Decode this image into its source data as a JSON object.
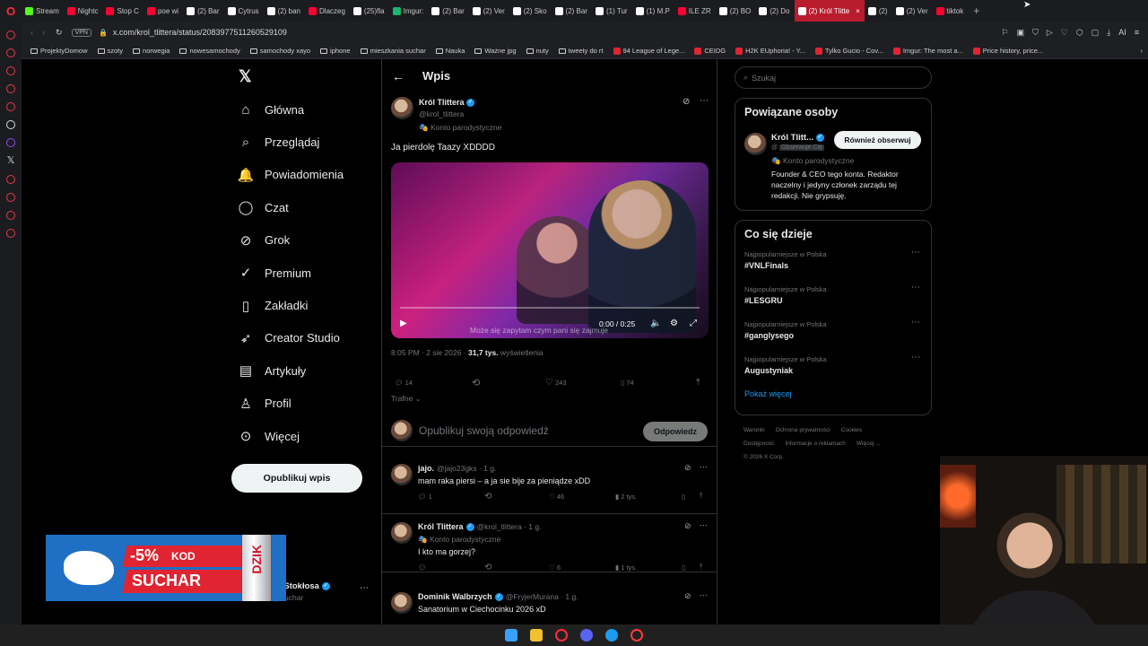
{
  "browser": {
    "tabs": [
      {
        "label": "Stream",
        "color": "#53fc18"
      },
      {
        "label": "Nightc",
        "color": "#ff0033"
      },
      {
        "label": "Stop C",
        "color": "#ff0033"
      },
      {
        "label": "poe wi",
        "color": "#ff0033"
      },
      {
        "label": "(2) Bar",
        "color": "#ffffff"
      },
      {
        "label": "Cytrus",
        "color": "#ffffff"
      },
      {
        "label": "(2) ban",
        "color": "#ffffff"
      },
      {
        "label": "Dlaczeg",
        "color": "#ff0033"
      },
      {
        "label": "(25)fla",
        "color": "#ffffff"
      },
      {
        "label": "Imgur:",
        "color": "#1bb76e"
      },
      {
        "label": "(2) Bar",
        "color": "#ffffff"
      },
      {
        "label": "(2) Ver",
        "color": "#ffffff"
      },
      {
        "label": "(2) Sko",
        "color": "#ffffff"
      },
      {
        "label": "(2) Bar",
        "color": "#ffffff"
      },
      {
        "label": "(1) Tur",
        "color": "#ffffff"
      },
      {
        "label": "(1) M.P",
        "color": "#ffffff"
      },
      {
        "label": "ILE ZR",
        "color": "#ff0033"
      },
      {
        "label": "(2) BO",
        "color": "#ffffff"
      },
      {
        "label": "(2) Do",
        "color": "#ffffff"
      },
      {
        "label": "(2) Król Tlitte",
        "color": "#ffffff",
        "active": true
      },
      {
        "label": "(2)",
        "color": "#ffffff"
      },
      {
        "label": "(2) Ver",
        "color": "#ffffff"
      },
      {
        "label": "tiktok",
        "color": "#ff0033"
      }
    ],
    "vpn_label": "VPN",
    "url": "x.com/krol_tlittera/status/2083977511260529109",
    "ai_label": "AI",
    "bookmarks": [
      {
        "label": "ProjektyDomow",
        "type": "folder"
      },
      {
        "label": "szoty",
        "type": "folder"
      },
      {
        "label": "norwegia",
        "type": "folder"
      },
      {
        "label": "nowesamochody",
        "type": "folder"
      },
      {
        "label": "samochody xayo",
        "type": "folder"
      },
      {
        "label": "iphone",
        "type": "folder"
      },
      {
        "label": "mieszkania suchar",
        "type": "folder"
      },
      {
        "label": "Nauka",
        "type": "folder"
      },
      {
        "label": "Ważne jpg",
        "type": "folder"
      },
      {
        "label": "nuty",
        "type": "folder"
      },
      {
        "label": "tweety do rt",
        "type": "folder"
      },
      {
        "label": "94 League of Lege...",
        "type": "site"
      },
      {
        "label": "CEIDG",
        "type": "site"
      },
      {
        "label": "H2K EUphoria! - Y...",
        "type": "site"
      },
      {
        "label": "Tylko Gucio - Cov...",
        "type": "site"
      },
      {
        "label": "Imgur: The most a...",
        "type": "site"
      },
      {
        "label": "Price history, price...",
        "type": "site"
      }
    ]
  },
  "nav": {
    "items": [
      {
        "label": "Główna",
        "icon": "home-icon",
        "glyph": "⌂"
      },
      {
        "label": "Przeglądaj",
        "icon": "search-icon",
        "glyph": "⌕"
      },
      {
        "label": "Powiadomienia",
        "icon": "bell-icon",
        "glyph": "🔔"
      },
      {
        "label": "Czat",
        "icon": "chat-icon",
        "glyph": "◯"
      },
      {
        "label": "Grok",
        "icon": "grok-icon",
        "glyph": "⊘"
      },
      {
        "label": "Premium",
        "icon": "premium-icon",
        "glyph": "✓"
      },
      {
        "label": "Zakładki",
        "icon": "bookmark-icon",
        "glyph": "▯"
      },
      {
        "label": "Creator Studio",
        "icon": "rocket-icon",
        "glyph": "➶"
      },
      {
        "label": "Artykuły",
        "icon": "article-icon",
        "glyph": "▤"
      },
      {
        "label": "Profil",
        "icon": "profile-icon",
        "glyph": "♙"
      },
      {
        "label": "Więcej",
        "icon": "more-icon",
        "glyph": "⊙"
      }
    ],
    "post_button": "Opublikuj wpis",
    "account_name": "nik Stokłosa",
    "account_handle": "krySuchar"
  },
  "post": {
    "header_title": "Wpis",
    "author_name": "Król Tlittera",
    "author_handle": "@krol_tlittera",
    "parody_label": "Konto parodystyczne",
    "text": "Ja pierdolę Taazy XDDDD",
    "video_time": "0:00 / 0:25",
    "video_subtitle": "Może się zapytam czym pani się zajmuje",
    "video_progress": 0,
    "meta_date": "8:05 PM · 2 sie 2026 · ",
    "views_count": "31,7 tys.",
    "views_label": " wyświetlenia",
    "replies": "14",
    "likes": "243",
    "bookmarks": "74",
    "sort_label": "Trafne",
    "reply_placeholder": "Opublikuj swoją odpowiedź",
    "reply_button": "Odpowiedz"
  },
  "replies": [
    {
      "name": "jajo.",
      "handle": "@jajo23gks · 1 g.",
      "text": "mam raka piersi – a ja sie bije za pieniądze xDD",
      "replies": "1",
      "likes": "46",
      "views": "2 tys.",
      "verified": false,
      "parody": ""
    },
    {
      "name": "Król Tlittera",
      "handle": "@krol_tlittera · 1 g.",
      "text": "I kto ma gorzej?",
      "replies": "",
      "likes": "6",
      "views": "1 tys.",
      "verified": true,
      "parody": "Konto parodystyczne"
    },
    {
      "name": "Dominik Walbrzych",
      "handle": "@FryjerMurana · 1 g.",
      "text": "Sanatorium w Ciechocinku 2026 xD",
      "replies": "",
      "likes": "",
      "views": "",
      "verified": true,
      "parody": ""
    }
  ],
  "sidebar": {
    "search_placeholder": "Szukaj",
    "related_title": "Powiązane osoby",
    "related_name": "Król Tlitt...",
    "related_follows_you": "Obserwuje Cię",
    "related_parody": "Konto parodystyczne",
    "related_follow_button": "Również obserwuj",
    "related_bio": "Founder & CEO tego konta. Redaktor naczelny i jedyny członek zarządu tej redakcji. Nie grypsuję.",
    "trends_title": "Co się dzieje",
    "trends": [
      {
        "context": "Najpopularniejsze w Polska",
        "name": "#VNLFinals"
      },
      {
        "context": "Najpopularniejsze w Polska",
        "name": "#LESGRU"
      },
      {
        "context": "Najpopularniejsze w Polska",
        "name": "#ganglysego"
      },
      {
        "context": "Najpopularniejsze w Polska",
        "name": "Augustyniak"
      }
    ],
    "show_more": "Pokaż więcej",
    "footer_line1": [
      "Warunki",
      "Ochrona prywatności",
      "Cookies"
    ],
    "footer_line2": [
      "Dostępność",
      "Informacje o reklamach",
      "Więcej ..."
    ],
    "footer_copy": "© 2026 X Corp."
  },
  "ad": {
    "discount": "-5%",
    "kod": "KOD",
    "code": "SUCHAR",
    "can_brand": "DZIK"
  },
  "colors": {
    "accent": "#1d9bf0",
    "active_tab": "#b91c2c",
    "ad_blue": "#1f6fc4",
    "ad_red": "#e02431"
  }
}
